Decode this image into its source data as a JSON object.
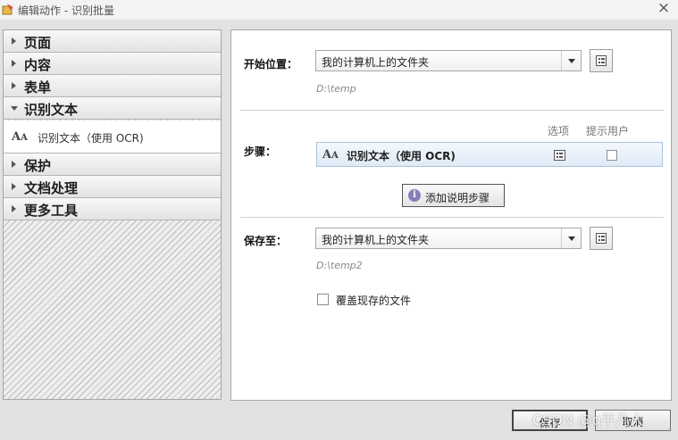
{
  "window": {
    "title": "编辑动作 - 识别批量",
    "close_glyph": "×"
  },
  "sidebar": {
    "items": [
      {
        "label": "页面",
        "expanded": false
      },
      {
        "label": "内容",
        "expanded": false
      },
      {
        "label": "表单",
        "expanded": false
      },
      {
        "label": "识别文本",
        "expanded": true
      },
      {
        "label": "保护",
        "expanded": false
      },
      {
        "label": "文档处理",
        "expanded": false
      },
      {
        "label": "更多工具",
        "expanded": false
      }
    ],
    "subitem": {
      "label": "识别文本（使用 OCR)",
      "icon": "font-size-icon"
    }
  },
  "main": {
    "start": {
      "label": "开始位置：",
      "dropdown_value": "我的计算机上的文件夹",
      "path": "D:\\temp"
    },
    "steps": {
      "label": "步骤：",
      "col_options": "选项",
      "col_prompt": "提示用户",
      "step_label": "识别文本（使用 OCR)",
      "prompt_checked": false,
      "add_button": "添加说明步骤"
    },
    "save": {
      "label": "保存至：",
      "dropdown_value": "我的计算机上的文件夹",
      "path": "D:\\temp2"
    },
    "overwrite": {
      "label": "覆盖现存的文件",
      "checked": false
    }
  },
  "footer": {
    "save_label": "保存",
    "cancel_label": "取消"
  },
  "watermark": "CSDN @q平凡人"
}
